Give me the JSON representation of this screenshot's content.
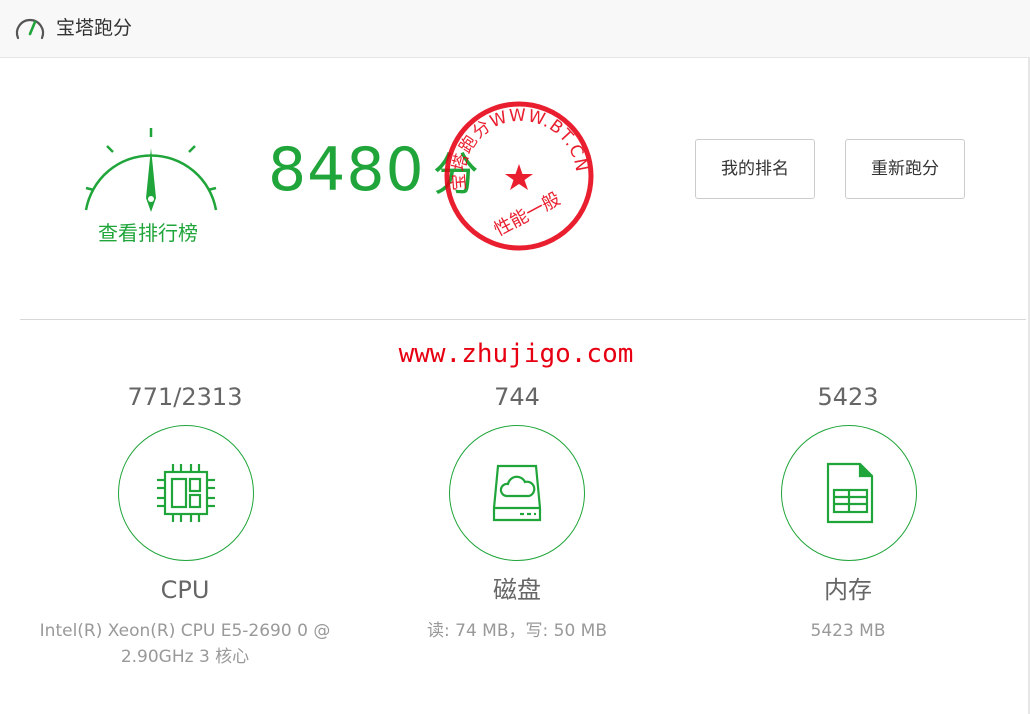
{
  "window": {
    "title": "宝塔跑分",
    "icon": "speedometer-icon"
  },
  "score": {
    "value": "8480",
    "unit": "分",
    "rank_link": "查看排行榜"
  },
  "stamp": {
    "ring_text": "宝塔跑分WWW.BT.CN",
    "verdict": "性能一般",
    "color": "#e60012"
  },
  "buttons": {
    "my_rank": "我的排名",
    "rerun": "重新跑分"
  },
  "watermark": "www.zhujigo.com",
  "metrics": [
    {
      "value": "771/2313",
      "name": "CPU",
      "desc_line1": "Intel(R) Xeon(R) CPU E5-2690 0 @",
      "desc_line2": "2.90GHz 3 核心",
      "icon": "cpu-chip-icon"
    },
    {
      "value": "744",
      "name": "磁盘",
      "desc_line1": "读: 74 MB，写: 50 MB",
      "desc_line2": "",
      "icon": "disk-drive-icon"
    },
    {
      "value": "5423",
      "name": "内存",
      "desc_line1": "5423 MB",
      "desc_line2": "",
      "icon": "memory-icon"
    }
  ],
  "colors": {
    "accent": "#20a53a",
    "stamp_red": "#e60012"
  }
}
